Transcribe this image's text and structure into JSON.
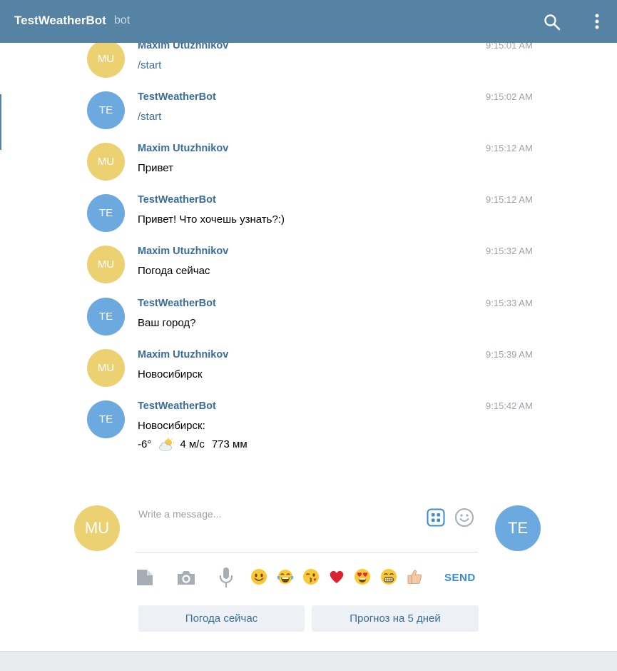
{
  "header": {
    "title": "TestWeatherBot",
    "badge": "bot",
    "search_icon": "search-icon",
    "more_icon": "vertical-dots-icon",
    "background": "#5682a3"
  },
  "messages": [
    {
      "initials": "MU",
      "author": "Maxim Utuzhnikov",
      "time": "9:15:01 AM",
      "text": "/start"
    },
    {
      "initials": "TE",
      "author": "TestWeatherBot",
      "time": "9:15:02 AM",
      "text": "/start"
    },
    {
      "initials": "MU",
      "author": "Maxim Utuzhnikov",
      "time": "9:15:12 AM",
      "text": "Привет"
    },
    {
      "initials": "TE",
      "author": "TestWeatherBot",
      "time": "9:15:12 AM",
      "text": "Привет! Что хочешь узнать?:)"
    },
    {
      "initials": "MU",
      "author": "Maxim Utuzhnikov",
      "time": "9:15:32 AM",
      "text": "Погода сейчас"
    },
    {
      "initials": "TE",
      "author": "TestWeatherBot",
      "time": "9:15:33 AM",
      "text": "Ваш город?"
    },
    {
      "initials": "MU",
      "author": "Maxim Utuzhnikov",
      "time": "9:15:39 AM",
      "text": "Новосибирск"
    },
    {
      "initials": "TE",
      "author": "TestWeatherBot",
      "time": "9:15:42 AM",
      "text": "Новосибирск:",
      "weather": {
        "temp": "-6°",
        "icon": "sun-behind-cloud-icon",
        "wind": "4 м/с",
        "pressure": "773 мм"
      }
    }
  ],
  "compose": {
    "self_initials": "MU",
    "peer_initials": "TE",
    "placeholder": "Write a message...",
    "bot_keyboard_icon": "bot-keyboard-icon",
    "emoji_icon": "emoji-smile-icon",
    "send_label": "SEND",
    "tools": [
      "attach-file-icon",
      "camera-icon",
      "microphone-icon"
    ],
    "quick_emojis": [
      "smiling-face-icon",
      "tears-of-joy-icon",
      "kissing-wink-icon",
      "red-heart-icon",
      "heart-eyes-icon",
      "grinning-icon",
      "thumbs-up-icon"
    ]
  },
  "keyboard": {
    "buttons": [
      "Погода сейчас",
      "Прогноз на 5 дней"
    ]
  },
  "colors": {
    "author": "#3a6d99",
    "timestamp": "#9aa3ab",
    "avatar_mu": "#ecd173",
    "avatar_te": "#6ba9df",
    "send": "#3a8bd1"
  }
}
